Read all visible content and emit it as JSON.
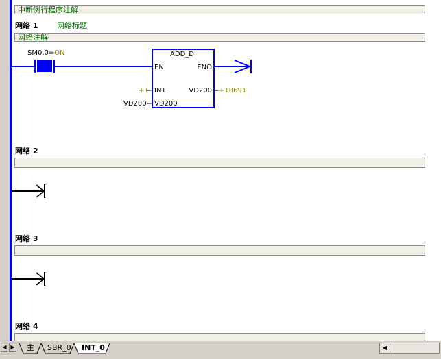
{
  "program_comment": "中断例行程序注解",
  "networks": [
    {
      "label": "网络 1",
      "title": "网络标题",
      "comment": "网络注解"
    },
    {
      "label": "网络 2"
    },
    {
      "label": "网络 3"
    },
    {
      "label": "网络 4"
    }
  ],
  "network1": {
    "contact_label": "SM0.0",
    "contact_eq": "=",
    "contact_state": "ON",
    "block_name": "ADD_DI",
    "pin_en": "EN",
    "pin_eno": "ENO",
    "pin_in1": "IN1",
    "pin_in2": "VD200",
    "pin_out": "VD200",
    "in1_value": "+1",
    "in2_operand": "VD200",
    "out_value": "+10691"
  },
  "tabs": [
    {
      "label": "主"
    },
    {
      "label": "SBR_0"
    },
    {
      "label": "INT_0"
    }
  ],
  "colors": {
    "rung": "#0000ff",
    "comment_text": "#006400",
    "status_value": "#808000"
  }
}
